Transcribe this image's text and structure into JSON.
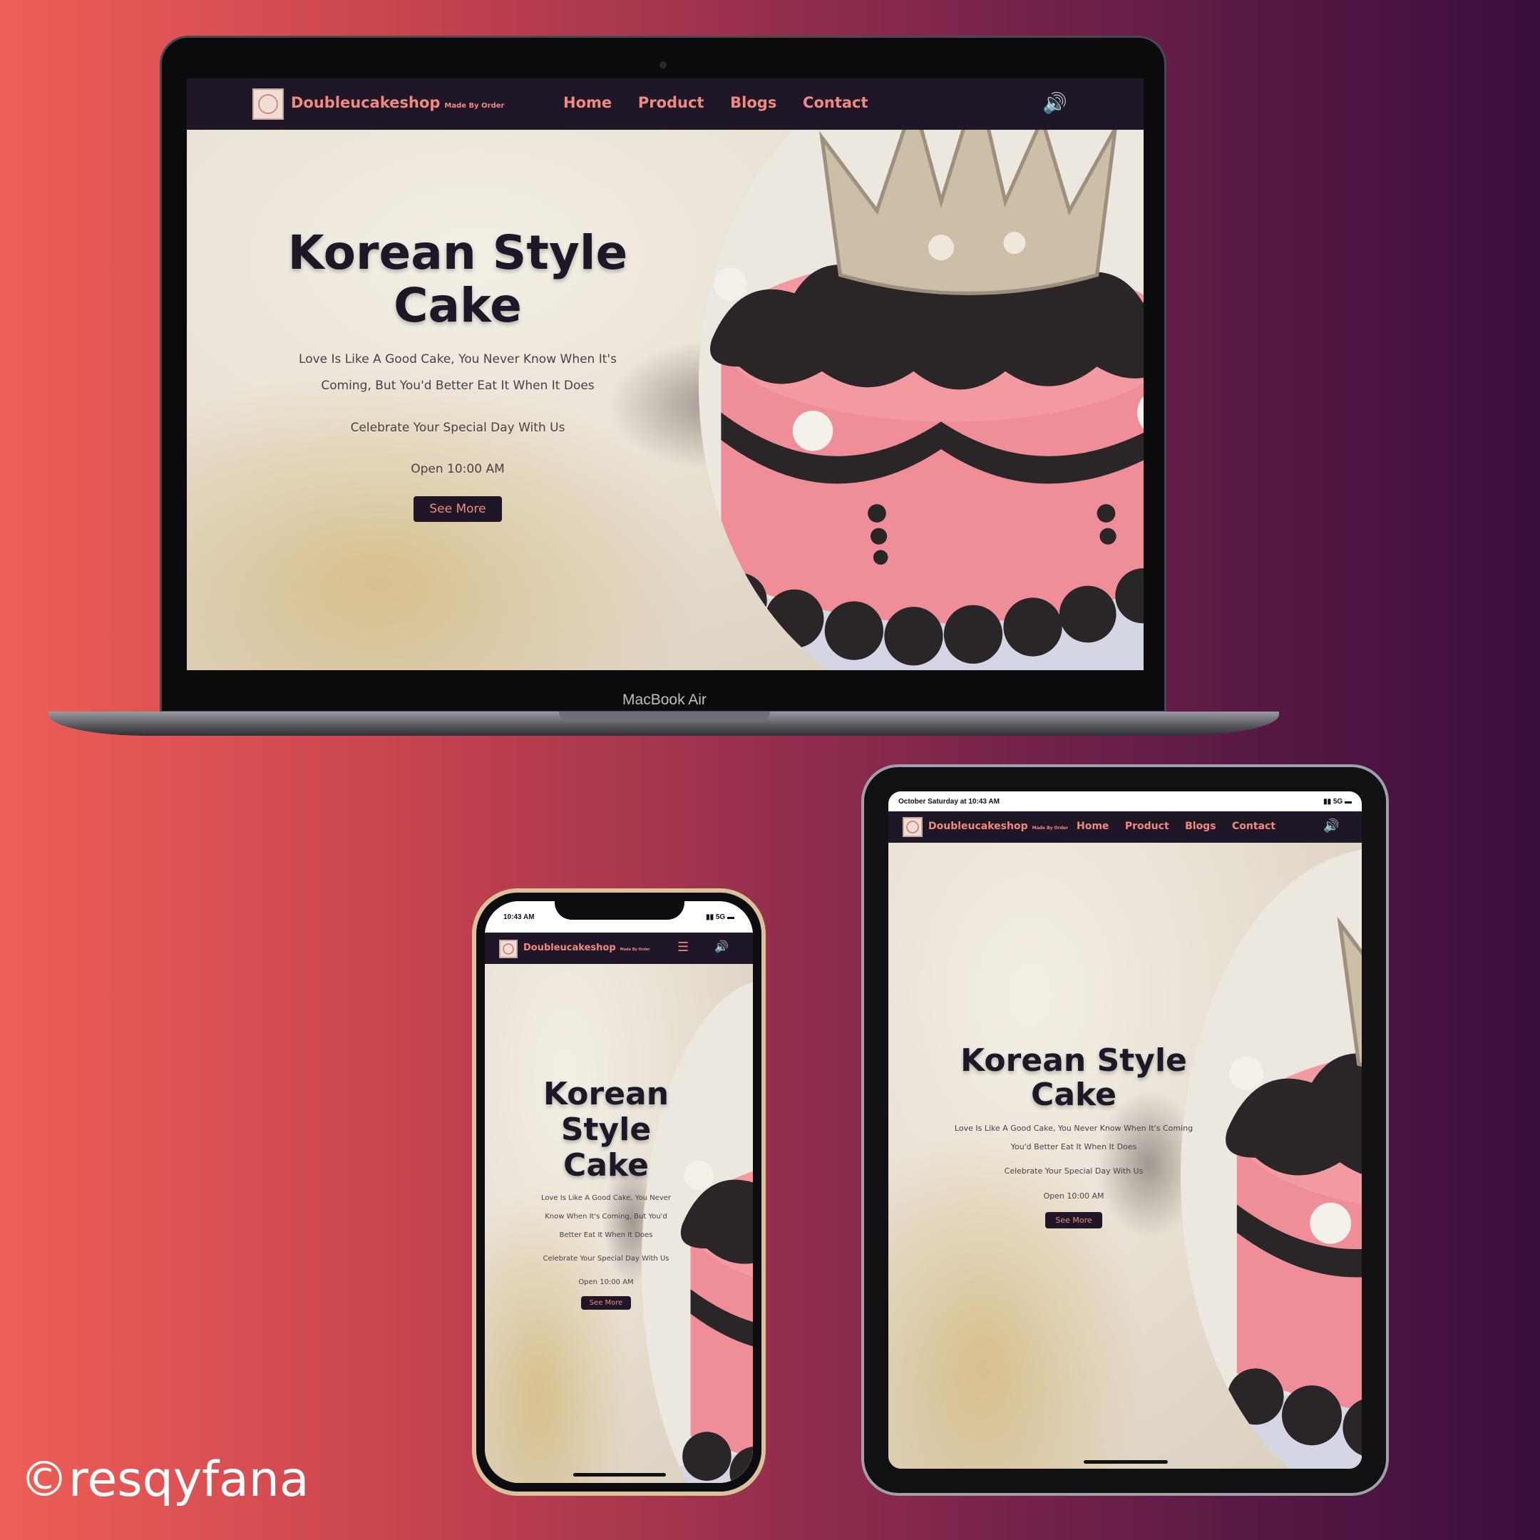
{
  "site": {
    "brand": "Doubleucakeshop",
    "tagline": "Made By Order",
    "nav": [
      "Home",
      "Product",
      "Blogs",
      "Contact"
    ],
    "hero": {
      "title_line1": "Korean Style",
      "title_line2": "Cake",
      "quote_line1": "Love Is Like A Good Cake, You Never Know When It's",
      "quote_line2": "Coming, But You'd Better Eat It When It Does",
      "celebrate": "Celebrate Your Special Day With Us",
      "open": "Open 10:00 AM",
      "button": "See More"
    }
  },
  "tablet": {
    "status_time": "October Saturday at 10:43 AM",
    "status_signal": "5G",
    "quote_line1": "Love Is Like A Good Cake, You Never Know When It's Coming",
    "quote_line2": "You'd Better Eat It When It Does"
  },
  "phone": {
    "status_time": "10:43 AM",
    "status_signal": "5G",
    "title_line1": "Korean",
    "title_line2": "Style",
    "title_line3": "Cake",
    "quote_line1": "Love Is Like A Good Cake, You Never",
    "quote_line2": "Know When It's Coming, But You'd",
    "quote_line3": "Better Eat It When It Does"
  },
  "laptop_label": "MacBook Air",
  "watermark": "©resqyfana",
  "icons": {
    "speaker": "speaker-icon",
    "menu": "hamburger-menu-icon",
    "logo": "cake-logo-icon"
  },
  "colors": {
    "nav_bg": "#1f1727",
    "accent": "#f08a80",
    "cake_pink": "#ef8e96",
    "frosting": "#2a2527"
  }
}
